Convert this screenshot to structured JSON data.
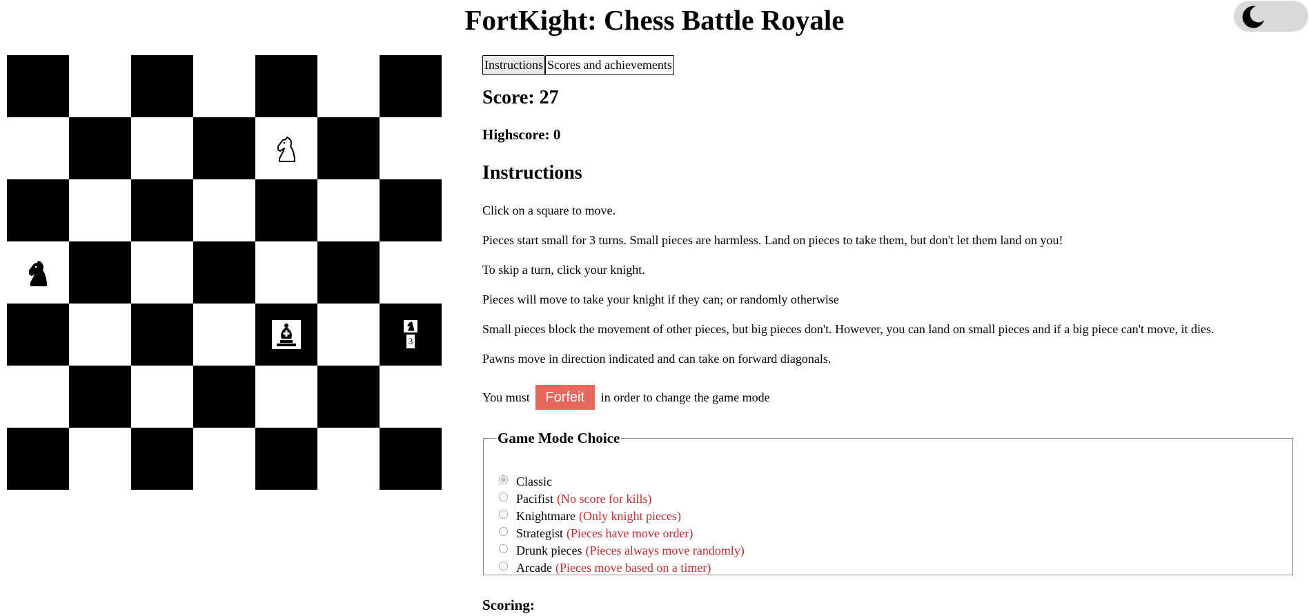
{
  "title": "FortKight: Chess Battle Royale",
  "theme_toggle": {
    "icon": "moon-icon"
  },
  "board": {
    "size": 7,
    "pieces": [
      {
        "row": 1,
        "col": 4,
        "type": "knight",
        "color": "white",
        "size": "big"
      },
      {
        "row": 3,
        "col": 0,
        "type": "knight",
        "color": "black",
        "size": "big"
      },
      {
        "row": 4,
        "col": 4,
        "type": "bishop",
        "color": "black",
        "size": "big"
      },
      {
        "row": 4,
        "col": 6,
        "type": "knight",
        "color": "black",
        "size": "small",
        "turns_left": "3"
      }
    ]
  },
  "tabs": [
    "Instructions",
    "Scores and achievements"
  ],
  "score_text": "Score: 27",
  "highscore_text": "Highscore: 0",
  "instructions": {
    "heading": "Instructions",
    "paragraphs": [
      "Click on a square to move.",
      "Pieces start small for 3 turns. Small pieces are harmless. Land on pieces to take them, but don't let them land on you!",
      "To skip a turn, click your knight.",
      "Pieces will move to take your knight if they can; or randomly otherwise",
      "Small pieces block the movement of other pieces, but big pieces don't. However, you can land on small pieces and if a big piece can't move, it dies.",
      "Pawns move in direction indicated and can take on forward diagonals."
    ],
    "forfeit_prefix": "You must",
    "forfeit_label": "Forfeit",
    "forfeit_suffix": "in order to change the game mode"
  },
  "game_mode": {
    "legend": "Game Mode Choice",
    "options": [
      {
        "label": "Classic",
        "desc": "",
        "checked": true
      },
      {
        "label": "Pacifist",
        "desc": "(No score for kills)",
        "checked": false
      },
      {
        "label": "Knightmare",
        "desc": "(Only knight pieces)",
        "checked": false
      },
      {
        "label": "Strategist",
        "desc": "(Pieces have move order)",
        "checked": false
      },
      {
        "label": "Drunk pieces",
        "desc": "(Pieces always move randomly)",
        "checked": false
      },
      {
        "label": "Arcade",
        "desc": "(Pieces move based on a timer)",
        "checked": false
      }
    ]
  },
  "scoring_heading": "Scoring:",
  "colors": {
    "forfeit": "#e8685e",
    "desc": "#cc2a2a",
    "toggle": "#d9d9d9"
  }
}
